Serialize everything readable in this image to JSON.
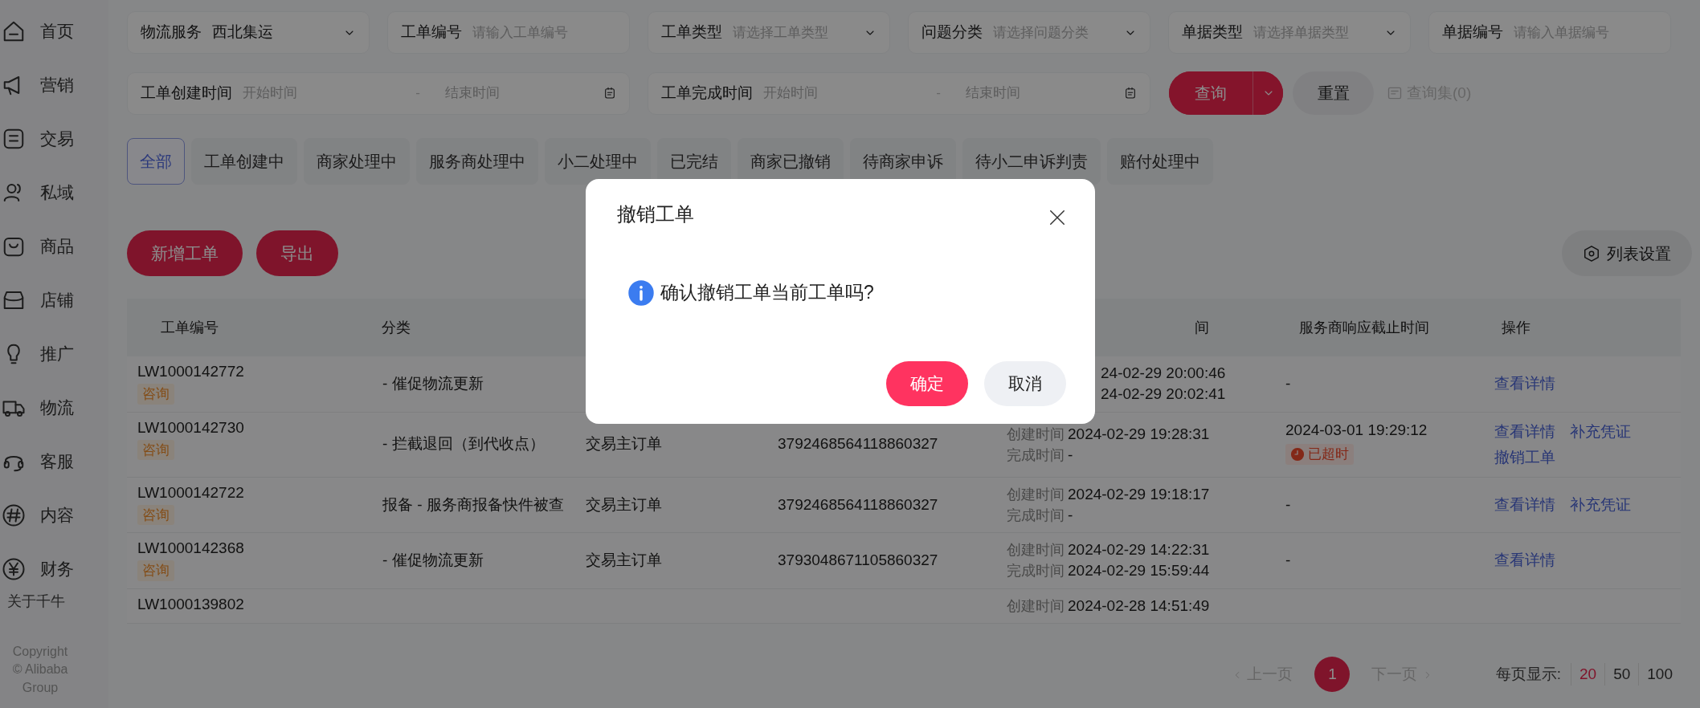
{
  "sidebar": {
    "items": [
      {
        "label": "首页"
      },
      {
        "label": "营销"
      },
      {
        "label": "交易"
      },
      {
        "label": "私域"
      },
      {
        "label": "商品"
      },
      {
        "label": "店铺"
      },
      {
        "label": "推广"
      },
      {
        "label": "物流"
      },
      {
        "label": "客服"
      },
      {
        "label": "内容"
      },
      {
        "label": "财务"
      }
    ],
    "about": "关于千牛",
    "copyright": [
      "Copyright",
      "© Alibaba",
      "Group"
    ]
  },
  "filters": [
    {
      "kind": "select",
      "label": "物流服务",
      "value": "西北集运"
    },
    {
      "kind": "input",
      "label": "工单编号",
      "placeholder": "请输入工单编号"
    },
    {
      "kind": "select",
      "label": "工单类型",
      "placeholder": "请选择工单类型"
    },
    {
      "kind": "select",
      "label": "问题分类",
      "placeholder": "请选择问题分类"
    },
    {
      "kind": "select",
      "label": "单据类型",
      "placeholder": "请选择单据类型"
    },
    {
      "kind": "input",
      "label": "单据编号",
      "placeholder": "请输入单据编号"
    }
  ],
  "date_ranges": [
    {
      "label": "工单创建时间",
      "start": {
        "placeholder": "开始时间"
      },
      "separator": "-",
      "end": {
        "placeholder": "结束时间"
      }
    },
    {
      "label": "工单完成时间",
      "start": {
        "placeholder": "开始时间"
      },
      "separator": "-",
      "end": {
        "placeholder": "结束时间"
      }
    }
  ],
  "query_button": "查询",
  "reset_button": "重置",
  "query_set": "查询集(0)",
  "status_tabs": [
    {
      "label": "全部",
      "selected": true
    },
    {
      "label": "工单创建中",
      "selected": false
    },
    {
      "label": "商家处理中",
      "selected": false
    },
    {
      "label": "服务商处理中",
      "selected": false
    },
    {
      "label": "小二处理中",
      "selected": false
    },
    {
      "label": "已完结",
      "selected": false
    },
    {
      "label": "商家已撤销",
      "selected": false
    },
    {
      "label": "待商家申诉",
      "selected": false
    },
    {
      "label": "待小二申诉判责",
      "selected": false
    },
    {
      "label": "赔付处理中",
      "selected": false
    }
  ],
  "toolbar": {
    "buttons": [
      "新增工单",
      "导出"
    ],
    "settings": "列表设置"
  },
  "table": {
    "columns": {
      "id": "工单编号",
      "category": "分类",
      "times": "间",
      "deadline": "服务商响应截止时间",
      "actions": "操作"
    },
    "rows": [
      {
        "id": "LW1000142772",
        "tag": "咨询",
        "category": "- 催促物流更新",
        "times": [
          {
            "time": "24-02-29 20:00:46"
          },
          {
            "time": "24-02-29 20:02:41"
          }
        ],
        "deadline": "-",
        "actions": [
          "查看详情"
        ]
      },
      {
        "id": "LW1000142730",
        "tag": "咨询",
        "category": "- 拦截退回（到代收点）",
        "order_type": "交易主订单",
        "order_no": "3792468564118860327",
        "times": [
          {
            "caption": "创建时间",
            "time": "2024-02-29 19:28:31"
          },
          {
            "caption": "完成时间",
            "time": "-"
          }
        ],
        "deadline": "2024-03-01 19:29:12",
        "overdue": "已超时",
        "actions": [
          "查看详情",
          "补充凭证",
          "撤销工单"
        ]
      },
      {
        "id": "LW1000142722",
        "tag": "咨询",
        "category": "报备 - 服务商报备快件被查",
        "order_type": "交易主订单",
        "order_no": "3792468564118860327",
        "times": [
          {
            "caption": "创建时间",
            "time": "2024-02-29 19:18:17"
          },
          {
            "caption": "完成时间",
            "time": "-"
          }
        ],
        "deadline": "-",
        "actions": [
          "查看详情",
          "补充凭证"
        ]
      },
      {
        "id": "LW1000142368",
        "tag": "咨询",
        "category": "- 催促物流更新",
        "order_type": "交易主订单",
        "order_no": "3793048671105860327",
        "times": [
          {
            "caption": "创建时间",
            "time": "2024-02-29 14:22:31"
          },
          {
            "caption": "完成时间",
            "time": "2024-02-29 15:59:44"
          }
        ],
        "deadline": "-",
        "actions": [
          "查看详情"
        ]
      },
      {
        "id": "LW1000139802",
        "times": [
          {
            "caption": "创建时间",
            "time": "2024-02-28 14:51:49"
          }
        ]
      }
    ]
  },
  "pagination": {
    "prev": {
      "label": "上一页",
      "disabled": true
    },
    "pages": [
      {
        "label": "1",
        "selected": true
      }
    ],
    "next": {
      "label": "下一页",
      "disabled": true
    },
    "page_size_label": "每页显示:",
    "sizes": [
      {
        "label": "20",
        "selected": true
      },
      {
        "label": "50",
        "selected": false
      },
      {
        "label": "100",
        "selected": false
      }
    ]
  },
  "dialog": {
    "title": "撤销工单",
    "message": "确认撤销工单当前工单吗?",
    "confirm": "确定",
    "cancel": "取消"
  }
}
